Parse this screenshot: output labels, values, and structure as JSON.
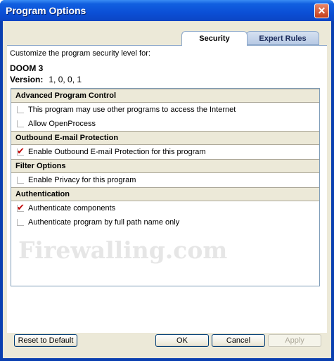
{
  "window": {
    "title": "Program Options",
    "close_glyph": "✕"
  },
  "tabs": [
    {
      "label": "Security",
      "active": true
    },
    {
      "label": "Expert Rules",
      "active": false
    }
  ],
  "intro_text": "Customize the program security level for:",
  "program": {
    "name": "DOOM 3",
    "version_label": "Version:",
    "version_value": "1, 0, 0, 1"
  },
  "sections": [
    {
      "title": "Advanced Program Control",
      "options": [
        {
          "label": "This program may use other programs to access the Internet",
          "checked": false
        },
        {
          "label": "Allow OpenProcess",
          "checked": false
        }
      ]
    },
    {
      "title": "Outbound E-mail Protection",
      "options": [
        {
          "label": "Enable Outbound E-mail Protection for this program",
          "checked": true
        }
      ]
    },
    {
      "title": "Filter Options",
      "options": [
        {
          "label": "Enable Privacy for this program",
          "checked": false
        }
      ]
    },
    {
      "title": "Authentication",
      "options": [
        {
          "label": "Authenticate components",
          "checked": true
        },
        {
          "label": "Authenticate program by full path name only",
          "checked": false
        }
      ]
    }
  ],
  "watermark": "Firewalling.com",
  "buttons": {
    "reset": "Reset to Default",
    "ok": "OK",
    "cancel": "Cancel",
    "apply": "Apply"
  },
  "colors": {
    "titlebar": "#0b4fd6",
    "check_mark": "#c00000",
    "dialog_bg": "#ece9d8"
  }
}
